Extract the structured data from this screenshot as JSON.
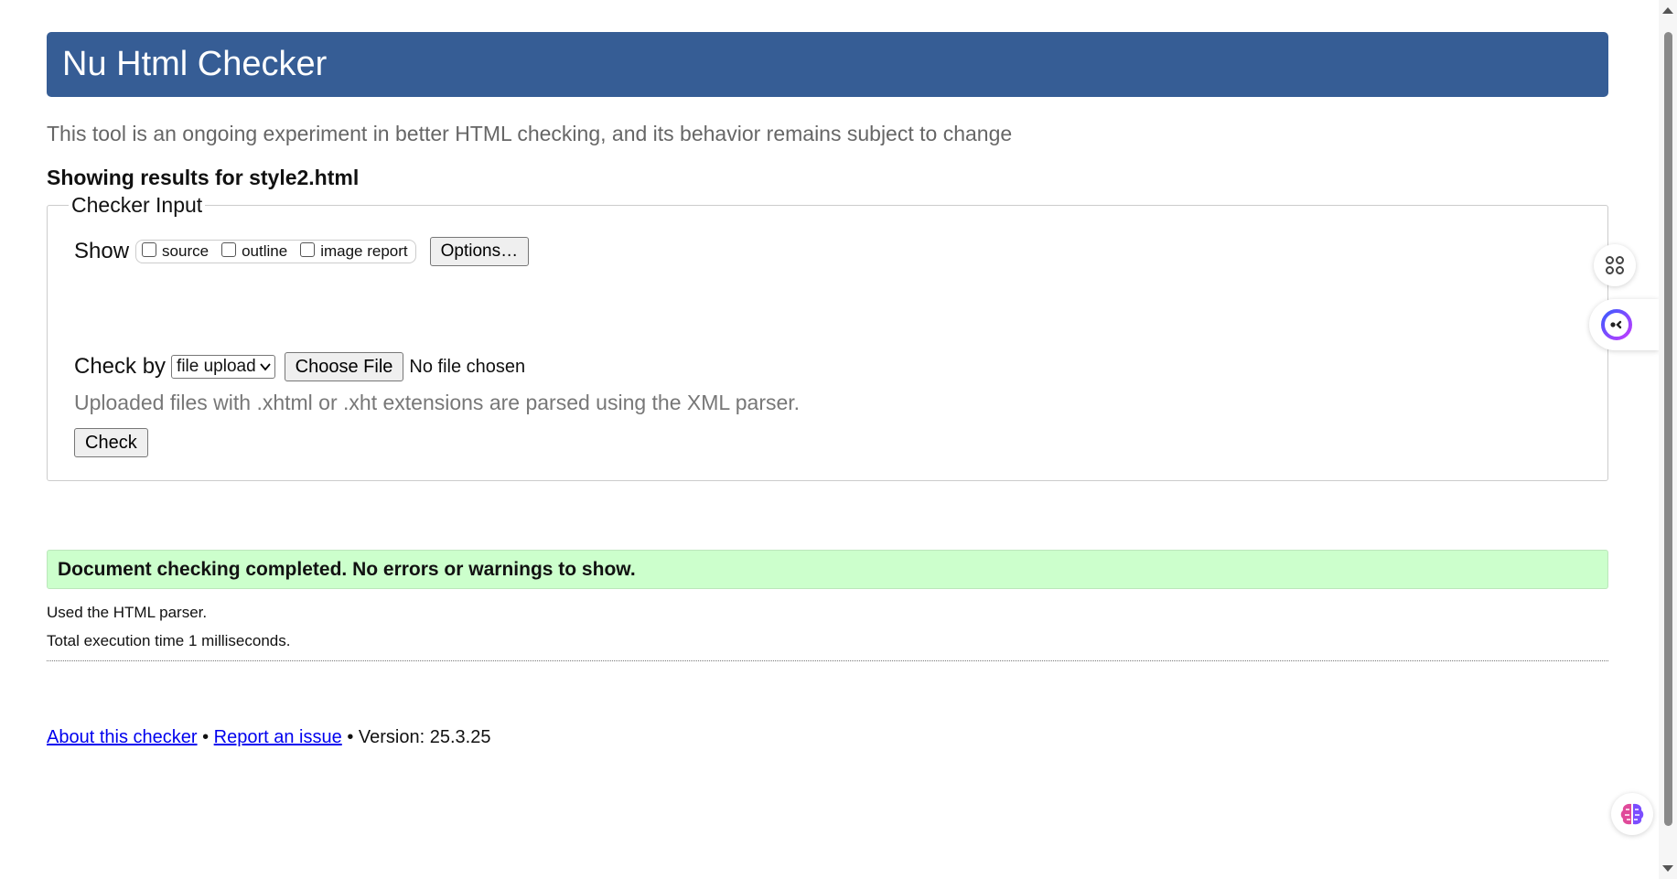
{
  "header": {
    "title": "Nu Html Checker"
  },
  "intro": {
    "subtitle": "This tool is an ongoing experiment in better HTML checking, and its behavior remains subject to change"
  },
  "results_for": "Showing results for style2.html",
  "checker_input": {
    "legend": "Checker Input",
    "show_label": "Show",
    "show_options": [
      {
        "label": "source",
        "checked": false
      },
      {
        "label": "outline",
        "checked": false
      },
      {
        "label": "image report",
        "checked": false
      }
    ],
    "options_button": "Options…",
    "check_by_label": "Check by",
    "check_by_selected": "file upload",
    "choose_file_button": "Choose File",
    "file_status": "No file chosen",
    "parser_note": "Uploaded files with .xhtml or .xht extensions are parsed using the XML parser.",
    "check_button": "Check"
  },
  "result": {
    "message": "Document checking completed. No errors or warnings to show.",
    "color": "#ccffcc"
  },
  "details": [
    "Used the HTML parser.",
    "Total execution time 1 milliseconds."
  ],
  "footer": {
    "about_link": "About this checker",
    "separator": "•",
    "report_link": "Report an issue",
    "version": "Version: 25.3.25"
  },
  "side_icons": [
    "shortcuts-icon",
    "assistant-face-icon",
    "brain-icon"
  ],
  "colors": {
    "header": "#365d95",
    "link": "#0000ee"
  }
}
